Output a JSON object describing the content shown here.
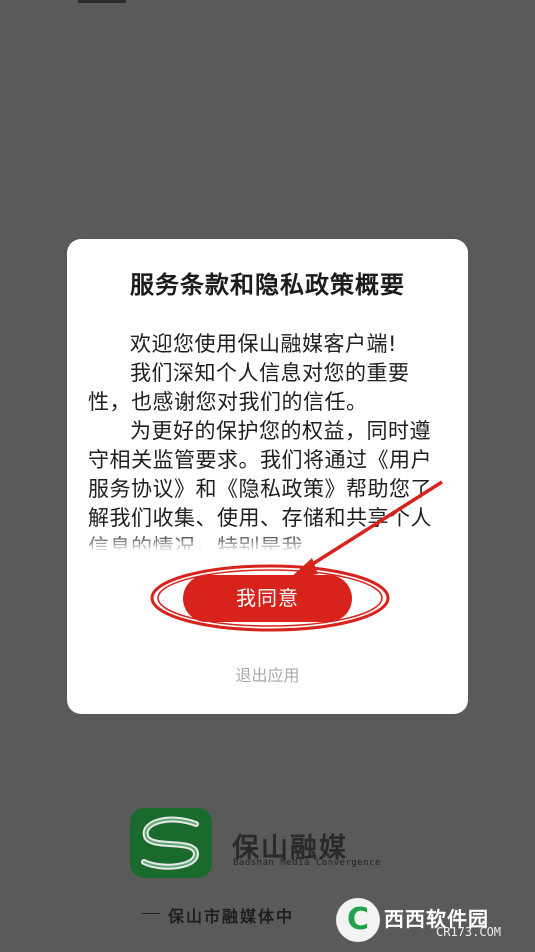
{
  "dialog": {
    "title": "服务条款和隐私政策概要",
    "paragraphs": [
      "欢迎您使用保山融媒客户端!",
      "我们深知个人信息对您的重要性，也感谢您对我们的信任。",
      "为更好的保护您的权益，同时遵守相关监管要求。我们将通过《用户服务协议》和《隐私政策》帮助您了解我们收集、使用、存储和共享个人信息的情况，特别是我"
    ],
    "agree_label": "我同意",
    "exit_label": "退出应用"
  },
  "brand": {
    "name": "保山融媒",
    "subtitle": "Baoshan Media Convergence",
    "footer": "保山市融媒体中"
  },
  "watermark": {
    "glyph": "C",
    "name": "西西软件园",
    "url": "CR173.COM"
  },
  "colors": {
    "accent_red": "#d8231d",
    "brand_green": "#1b6a2d"
  }
}
